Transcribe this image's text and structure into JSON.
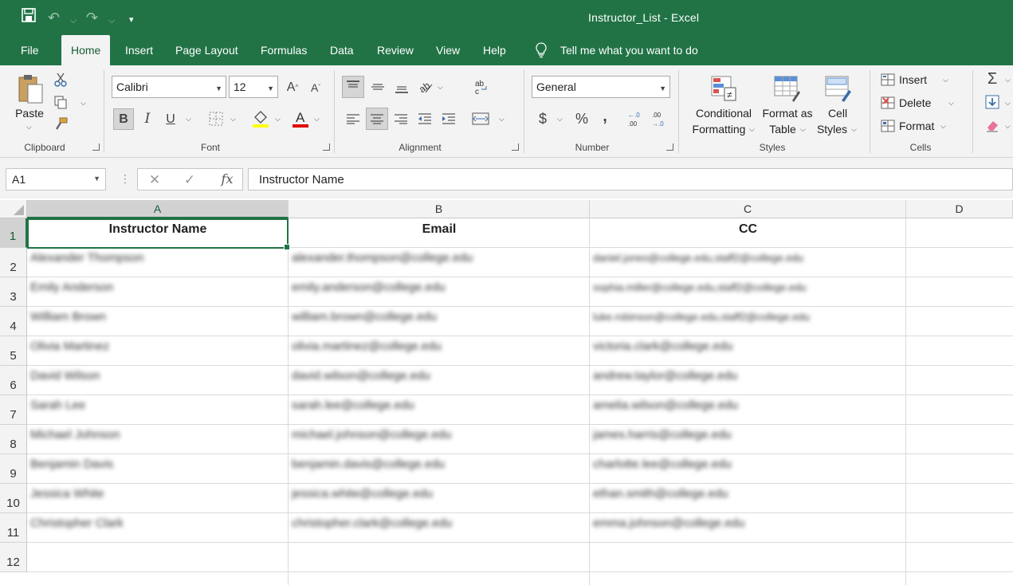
{
  "app": {
    "window_title": "Instructor_List  -  Excel",
    "accent_color": "#217346"
  },
  "quick_access": {
    "save_icon": "save-icon",
    "undo_icon": "undo-icon",
    "redo_icon": "redo-icon",
    "customize_icon": "customize-qat-icon"
  },
  "tabs": [
    {
      "label": "File"
    },
    {
      "label": "Home"
    },
    {
      "label": "Insert"
    },
    {
      "label": "Page Layout"
    },
    {
      "label": "Formulas"
    },
    {
      "label": "Data"
    },
    {
      "label": "Review"
    },
    {
      "label": "View"
    },
    {
      "label": "Help"
    }
  ],
  "active_tab": "Home",
  "tell_me": "Tell me what you want to do",
  "ribbon": {
    "clipboard": {
      "group": "Clipboard",
      "paste": "Paste"
    },
    "font": {
      "group": "Font",
      "font_name": "Calibri",
      "font_size": "12",
      "bold": "B",
      "italic": "I",
      "underline": "U"
    },
    "alignment": {
      "group": "Alignment"
    },
    "number": {
      "group": "Number",
      "format": "General",
      "currency": "$",
      "percent": "%",
      "comma": ","
    },
    "styles": {
      "group": "Styles",
      "conditional_1": "Conditional",
      "conditional_2": "Formatting",
      "format_table_1": "Format as",
      "format_table_2": "Table",
      "cell_styles_1": "Cell",
      "cell_styles_2": "Styles"
    },
    "cells": {
      "group": "Cells",
      "insert": "Insert",
      "delete": "Delete",
      "format": "Format"
    }
  },
  "formula_bar": {
    "name_box": "A1",
    "cancel": "✕",
    "enter": "✓",
    "fx": "fx",
    "value": "Instructor Name"
  },
  "grid": {
    "columns": [
      "A",
      "B",
      "C",
      "D"
    ],
    "rows": [
      "1",
      "2",
      "3",
      "4",
      "5",
      "6",
      "7",
      "8",
      "9",
      "10",
      "11",
      "12"
    ],
    "headers": [
      "Instructor Name",
      "Email",
      "CC"
    ],
    "data": [
      [
        "Alexander Thompson",
        "alexander.thompson@college.edu",
        "daniel.jones@college.edu,staff2@college.edu"
      ],
      [
        "Emily Anderson",
        "emily.anderson@college.edu",
        "sophia.miller@college.edu,staff2@college.edu"
      ],
      [
        "William Brown",
        "william.brown@college.edu",
        "luke.robinson@college.edu,staff2@college.edu"
      ],
      [
        "Olivia Martinez",
        "olivia.martinez@college.edu",
        "victoria.clark@college.edu"
      ],
      [
        "David Wilson",
        "david.wilson@college.edu",
        "andrew.taylor@college.edu"
      ],
      [
        "Sarah Lee",
        "sarah.lee@college.edu",
        "amelia.wilson@college.edu"
      ],
      [
        "Michael Johnson",
        "michael.johnson@college.edu",
        "james.harris@college.edu"
      ],
      [
        "Benjamin Davis",
        "benjamin.davis@college.edu",
        "charlotte.lee@college.edu"
      ],
      [
        "Jessica White",
        "jessica.white@college.edu",
        "ethan.smith@college.edu"
      ],
      [
        "Christopher Clark",
        "christopher.clark@college.edu",
        "emma.johnson@college.edu"
      ]
    ]
  }
}
